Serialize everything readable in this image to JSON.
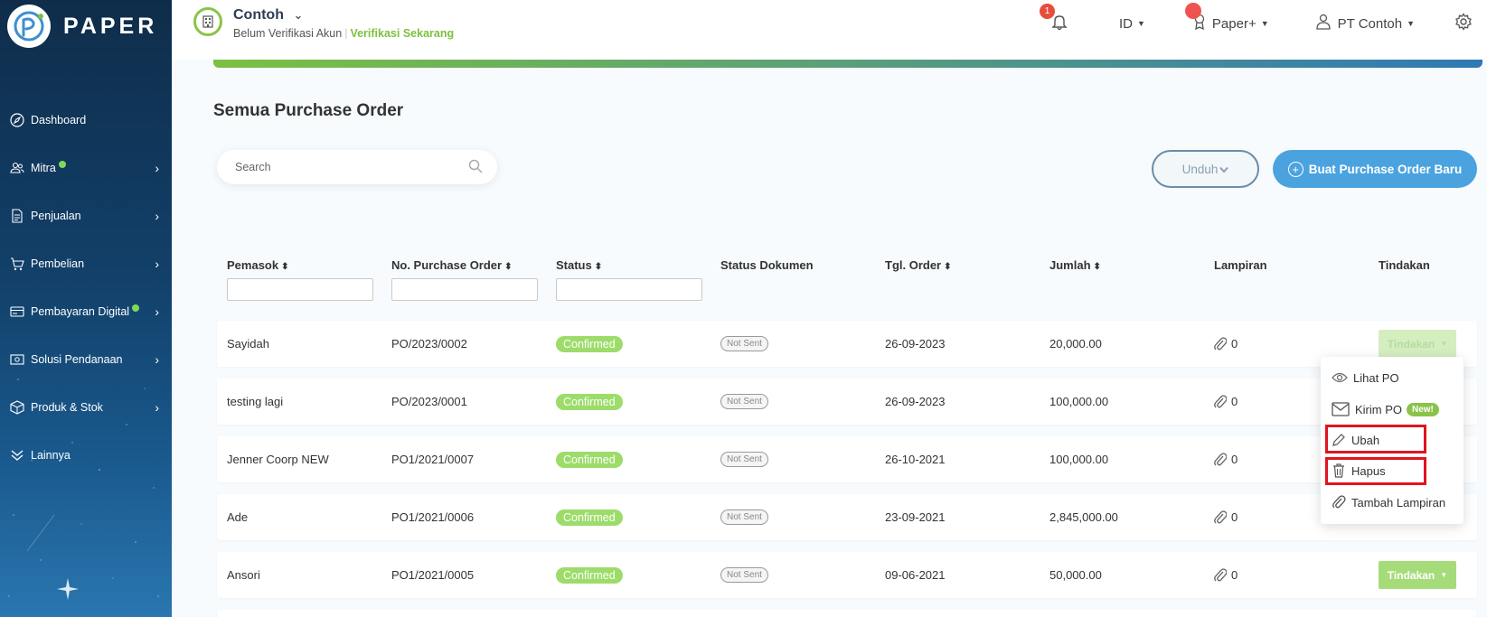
{
  "sidebar": {
    "brand": "PAPER",
    "items": [
      {
        "label": "Dashboard",
        "icon": "compass-icon",
        "chevron": false,
        "dot": false
      },
      {
        "label": "Mitra",
        "icon": "users-icon",
        "chevron": true,
        "dot": true
      },
      {
        "label": "Penjualan",
        "icon": "document-icon",
        "chevron": true,
        "dot": false
      },
      {
        "label": "Pembelian",
        "icon": "cart-icon",
        "chevron": true,
        "dot": false
      },
      {
        "label": "Pembayaran Digital",
        "icon": "card-icon",
        "chevron": true,
        "dot": true
      },
      {
        "label": "Solusi Pendanaan",
        "icon": "cash-icon",
        "chevron": true,
        "dot": false
      },
      {
        "label": "Produk & Stok",
        "icon": "box-icon",
        "chevron": true,
        "dot": false
      },
      {
        "label": "Lainnya",
        "icon": "double-chevron-down-icon",
        "chevron": false,
        "dot": false
      }
    ]
  },
  "header": {
    "company_name": "Contoh",
    "verify_status": "Belum Verifikasi Akun",
    "verify_link": "Verifikasi Sekarang",
    "notification_count": "1",
    "language": "ID",
    "plan": "Paper+",
    "account": "PT Contoh"
  },
  "main": {
    "title": "Semua Purchase Order",
    "search_placeholder": "Search",
    "download_label": "Unduh",
    "new_po_label": "Buat Purchase Order Baru"
  },
  "table": {
    "columns": [
      "Pemasok",
      "No. Purchase Order",
      "Status",
      "Status Dokumen",
      "Tgl. Order",
      "Jumlah",
      "Lampiran",
      "Tindakan"
    ],
    "rows": [
      {
        "supplier": "Sayidah",
        "po": "PO/2023/0002",
        "status": "Confirmed",
        "doc": "Not Sent",
        "date": "26-09-2023",
        "amount": "20,000.00",
        "attach": "0"
      },
      {
        "supplier": "testing lagi",
        "po": "PO/2023/0001",
        "status": "Confirmed",
        "doc": "Not Sent",
        "date": "26-09-2023",
        "amount": "100,000.00",
        "attach": "0"
      },
      {
        "supplier": "Jenner Coorp NEW",
        "po": "PO1/2021/0007",
        "status": "Confirmed",
        "doc": "Not Sent",
        "date": "26-10-2021",
        "amount": "100,000.00",
        "attach": "0"
      },
      {
        "supplier": "Ade",
        "po": "PO1/2021/0006",
        "status": "Confirmed",
        "doc": "Not Sent",
        "date": "23-09-2021",
        "amount": "2,845,000.00",
        "attach": "0"
      },
      {
        "supplier": "Ansori",
        "po": "PO1/2021/0005",
        "status": "Confirmed",
        "doc": "Not Sent",
        "date": "09-06-2021",
        "amount": "50,000.00",
        "attach": "0"
      }
    ],
    "action_label": "Tindakan"
  },
  "dropdown": {
    "view": "Lihat PO",
    "send": "Kirim PO",
    "new_badge": "New!",
    "edit": "Ubah",
    "delete": "Hapus",
    "add_attachment": "Tambah Lampiran"
  },
  "colors": {
    "accent_blue": "#4aa3df",
    "status_green": "#9ddc6a",
    "highlight_red": "#e0141e"
  }
}
